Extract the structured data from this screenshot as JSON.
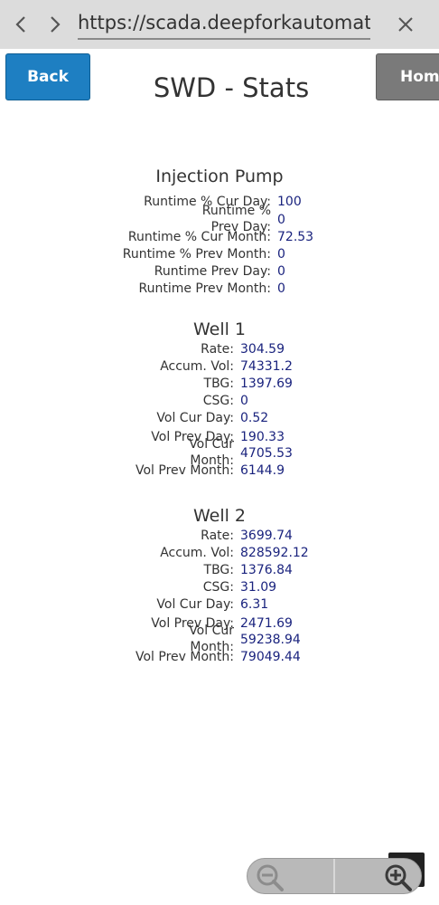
{
  "browser": {
    "url": "https://scada.deepforkautomatic"
  },
  "header": {
    "back_label": "Back",
    "home_label": "Hom",
    "title": "SWD - Stats"
  },
  "injection_pump": {
    "title": "Injection Pump",
    "rows": [
      {
        "label": "Runtime % Cur Day:",
        "value": "100"
      },
      {
        "label": "Runtime % Prev Day:",
        "value": "0"
      },
      {
        "label": "Runtime % Cur Month:",
        "value": "72.53"
      },
      {
        "label": "Runtime % Prev Month:",
        "value": "0"
      },
      {
        "label": "Runtime Prev Day:",
        "value": "0"
      },
      {
        "label": "Runtime Prev Month:",
        "value": "0"
      }
    ]
  },
  "well1": {
    "title": "Well 1",
    "rows": [
      {
        "label": "Rate:",
        "value": "304.59"
      },
      {
        "label": "Accum. Vol:",
        "value": "74331.2"
      },
      {
        "label": "TBG:",
        "value": "1397.69"
      },
      {
        "label": "CSG:",
        "value": "0"
      },
      {
        "label": "Vol Cur Day:",
        "value": "0.52"
      },
      {
        "label": "Vol Prev Day:",
        "value": "190.33"
      },
      {
        "label": "Vol Cur Month:",
        "value": "4705.53"
      },
      {
        "label": "Vol Prev Month:",
        "value": "6144.9"
      }
    ]
  },
  "well2": {
    "title": "Well 2",
    "rows": [
      {
        "label": "Rate:",
        "value": "3699.74"
      },
      {
        "label": "Accum. Vol:",
        "value": "828592.12"
      },
      {
        "label": "TBG:",
        "value": "1376.84"
      },
      {
        "label": "CSG:",
        "value": "31.09"
      },
      {
        "label": "Vol Cur Day:",
        "value": "6.31"
      },
      {
        "label": "Vol Prev Day:",
        "value": "2471.69"
      },
      {
        "label": "Vol Cur Month:",
        "value": "59238.94"
      },
      {
        "label": "Vol Prev Month:",
        "value": "79049.44"
      }
    ]
  },
  "icons": {
    "nav_back": "chevron-left-icon",
    "nav_forward": "chevron-right-icon",
    "close": "close-icon",
    "zoom_out": "zoom-out-icon",
    "zoom_in": "zoom-in-icon"
  },
  "colors": {
    "back_button": "#1e7fc2",
    "home_button": "#7a7a7a",
    "value_text": "#1a237e",
    "browser_bar": "#dcdcdc"
  }
}
